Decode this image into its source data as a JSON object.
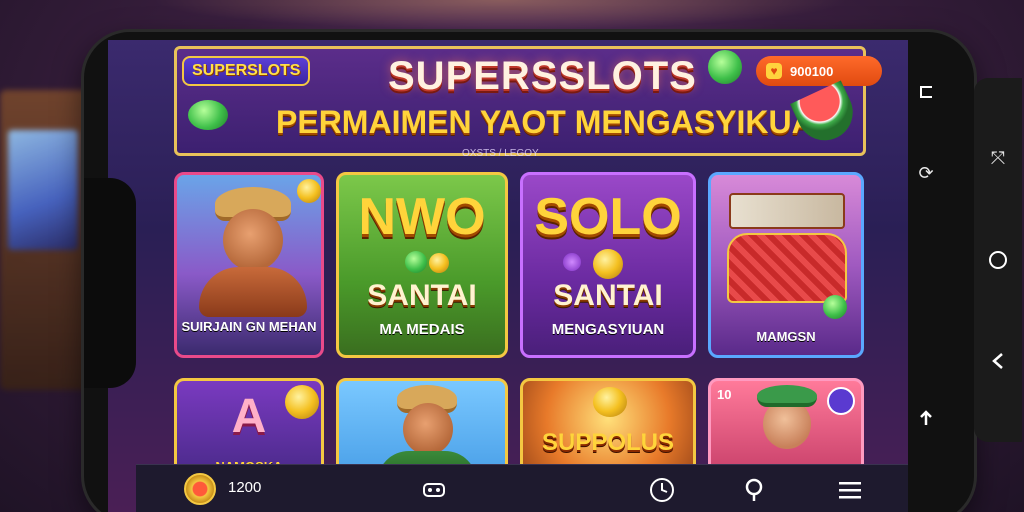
{
  "banner": {
    "logo": "SUPERSLOTS",
    "title": "SUPERSSLOTS",
    "subtitle": "PERMAIMEN YAOT MENGASYIKUAN",
    "small_text": "OXSTS / LEGOY",
    "balance": "900100"
  },
  "cards": [
    {
      "id": "c1",
      "label": "SUIRJAIN GN MEHAN"
    },
    {
      "id": "c2",
      "word": "NWO",
      "title": "SANTAI",
      "label": "MA MEDAIS"
    },
    {
      "id": "c3",
      "word": "SOLO",
      "title": "SANTAI",
      "label": "MENGASYIUAN"
    },
    {
      "id": "c4",
      "label": "MAMGSN"
    },
    {
      "id": "c5",
      "word": "A",
      "label": "NAMOSKA"
    },
    {
      "id": "c6",
      "label": ""
    },
    {
      "id": "c7",
      "label": "SUPPOLUS"
    },
    {
      "id": "c8",
      "label": "10"
    }
  ],
  "bottom_bar": {
    "count": "1200"
  },
  "icons": {
    "nav_right": [
      "menu-icon",
      "refresh-icon",
      "home-circle-icon",
      "back-icon",
      "share-icon"
    ],
    "bottom": [
      "coin-avatar-icon",
      "game-controller-icon",
      "clock-icon",
      "location-pin-icon",
      "hamburger-menu-icon"
    ]
  },
  "colors": {
    "accent": "#f4c842",
    "balance_pill": "#ff6a2a",
    "banner_bg": "#5b2d8a"
  }
}
